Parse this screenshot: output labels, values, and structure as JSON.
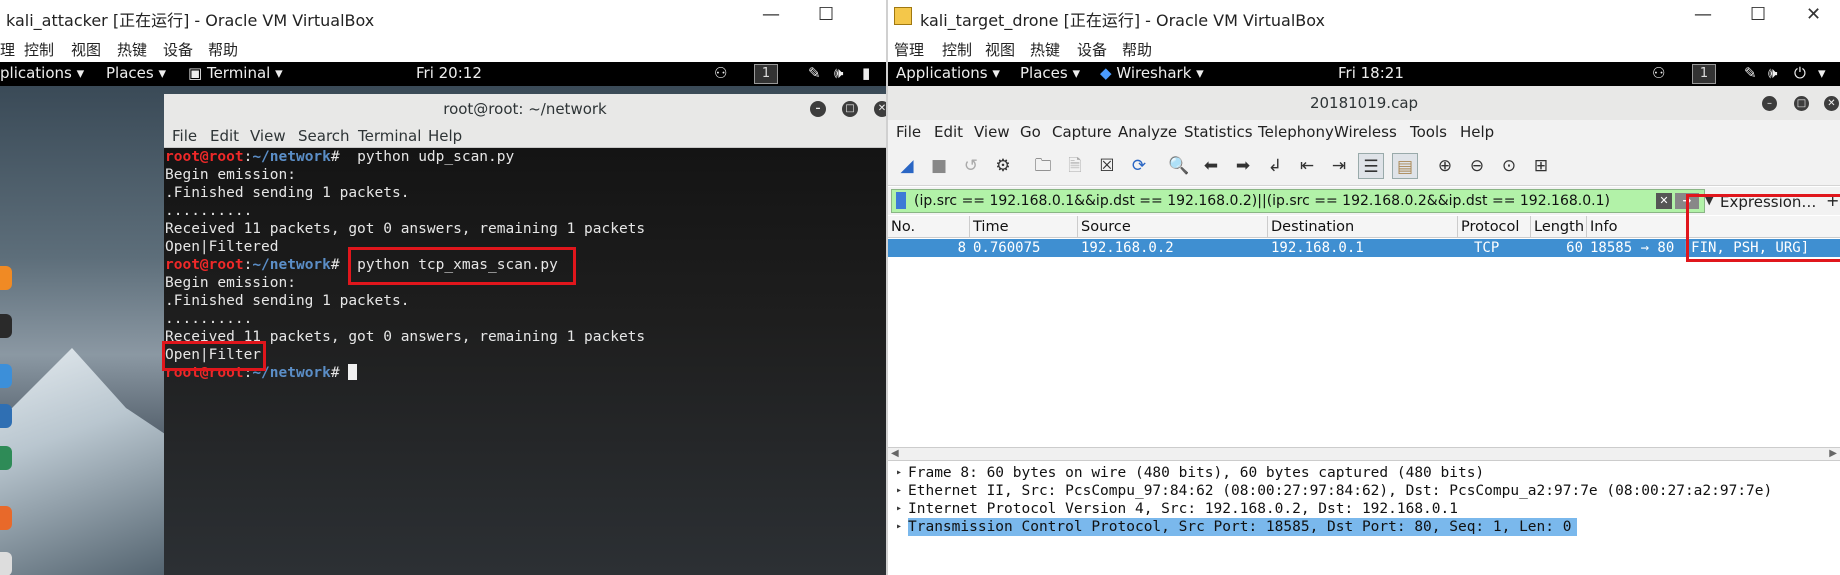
{
  "left_vm": {
    "title": "kali_attacker [正在运行] - Oracle VM VirtualBox",
    "menu": [
      "理",
      "控制",
      "视图",
      "热键",
      "设备",
      "帮助"
    ],
    "topbar": {
      "applications": "plications ▾",
      "places": "Places ▾",
      "app": "Terminal ▾",
      "clock": "Fri 20:12",
      "workspace": "1"
    },
    "terminal": {
      "title": "root@root: ~/network",
      "menu": [
        "File",
        "Edit",
        "View",
        "Search",
        "Terminal",
        "Help"
      ],
      "prompt_user": "root@root",
      "prompt_path": "~/network",
      "lines": [
        {
          "type": "prompt",
          "cmd": " python udp_scan.py"
        },
        {
          "type": "out",
          "text": "Begin emission:"
        },
        {
          "type": "out",
          "text": ".Finished sending 1 packets."
        },
        {
          "type": "out",
          "text": ".........."
        },
        {
          "type": "out",
          "text": "Received 11 packets, got 0 answers, remaining 1 packets"
        },
        {
          "type": "out",
          "text": "Open|Filtered"
        },
        {
          "type": "prompt",
          "cmd": " python tcp_xmas_scan.py"
        },
        {
          "type": "out",
          "text": "Begin emission:"
        },
        {
          "type": "out",
          "text": ".Finished sending 1 packets."
        },
        {
          "type": "out",
          "text": ".........."
        },
        {
          "type": "out",
          "text": "Received 11 packets, got 0 answers, remaining 1 packets"
        },
        {
          "type": "out",
          "text": "Open|Filter"
        },
        {
          "type": "prompt",
          "cmd": " "
        }
      ]
    }
  },
  "right_vm": {
    "title": "kali_target_drone [正在运行] - Oracle VM VirtualBox",
    "menu": [
      "管理",
      "控制",
      "视图",
      "热键",
      "设备",
      "帮助"
    ],
    "topbar": {
      "applications": "Applications ▾",
      "places": "Places ▾",
      "app": "Wireshark ▾",
      "clock": "Fri 18:21",
      "workspace": "1"
    },
    "wireshark": {
      "title": "20181019.cap",
      "menu": [
        "File",
        "Edit",
        "View",
        "Go",
        "Capture",
        "Analyze",
        "Statistics",
        "Telephony",
        "Wireless",
        "Tools",
        "Help"
      ],
      "filter": "(ip.src == 192.168.0.1&&ip.dst == 192.168.0.2)||(ip.src == 192.168.0.2&&ip.dst == 192.168.0.1)",
      "expression_label": "Expression…",
      "columns": [
        "No.",
        "Time",
        "Source",
        "Destination",
        "Protocol",
        "Length",
        "Info"
      ],
      "packet": {
        "no": "8",
        "time": "0.760075",
        "source": "192.168.0.2",
        "destination": "192.168.0.1",
        "protocol": "TCP",
        "length": "60",
        "info": "18585 → 80 [FIN, PSH, URG]"
      },
      "details": [
        "Frame 8: 60 bytes on wire (480 bits), 60 bytes captured (480 bits)",
        "Ethernet II, Src: PcsCompu_97:84:62 (08:00:27:97:84:62), Dst: PcsCompu_a2:97:7e (08:00:27:a2:97:7e)",
        "Internet Protocol Version 4, Src: 192.168.0.2, Dst: 192.168.0.1",
        "Transmission Control Protocol, Src Port: 18585, Dst Port: 80, Seq: 1, Len: 0"
      ]
    }
  }
}
